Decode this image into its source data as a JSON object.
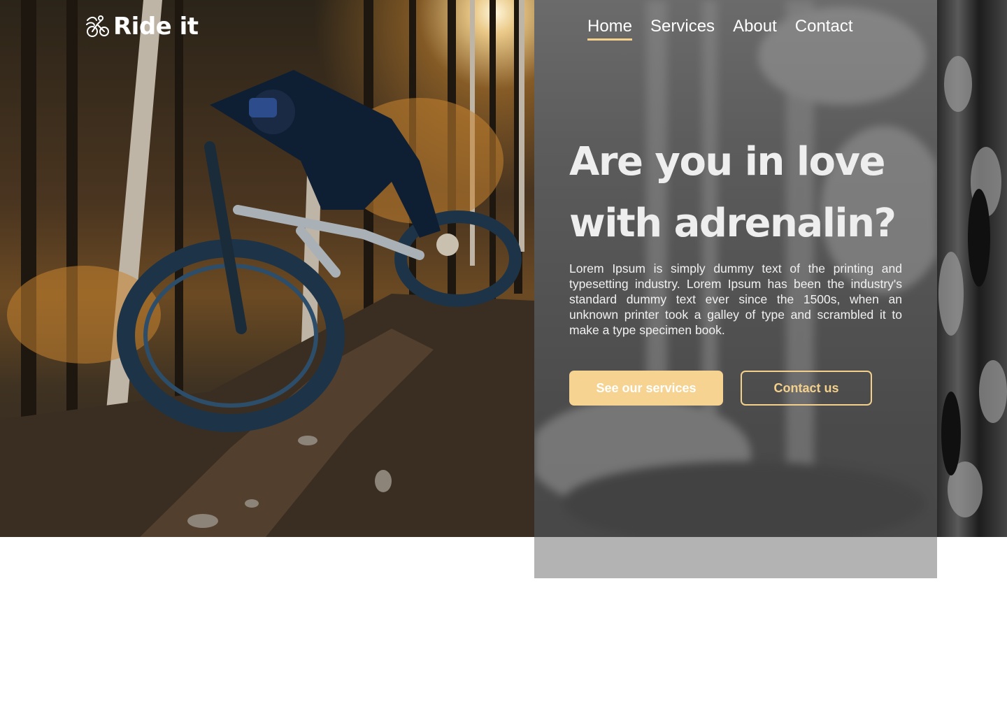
{
  "brand": {
    "name": "Ride it",
    "logo_icon": "bike-rider-icon"
  },
  "nav": {
    "items": [
      {
        "label": "Home",
        "active": true
      },
      {
        "label": "Services",
        "active": false
      },
      {
        "label": "About",
        "active": false
      },
      {
        "label": "Contact",
        "active": false
      }
    ]
  },
  "hero": {
    "headline_line1": "Are you in love",
    "headline_line2": "with adrenalin?",
    "body": "Lorem Ipsum is simply dummy text of the printing and typesetting industry. Lorem Ipsum has been the industry's standard dummy text ever since the 1500s, when an unknown printer took a galley of type and scrambled it to make a type specimen book.",
    "primary_cta": "See our services",
    "secondary_cta": "Contact us"
  },
  "colors": {
    "accent": "#f6d390",
    "panel_overlay": "#5a5a5a",
    "text": "#ffffff"
  }
}
